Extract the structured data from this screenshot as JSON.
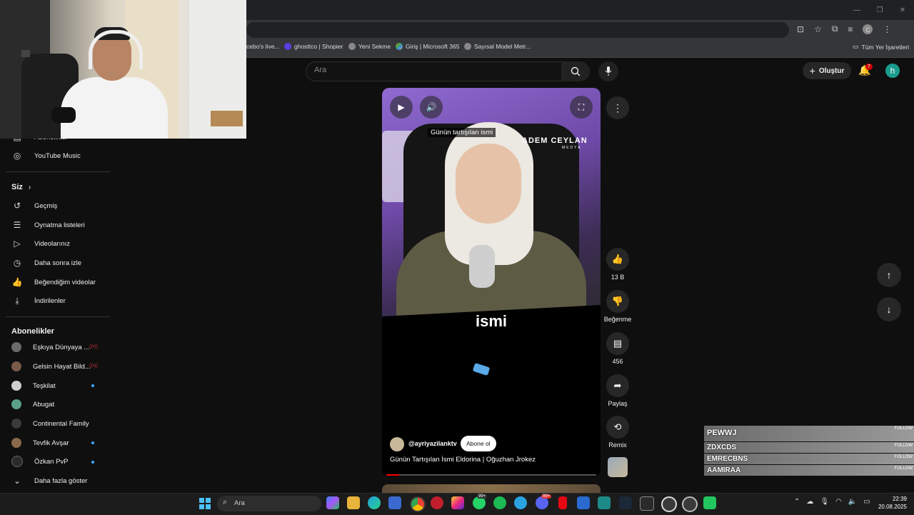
{
  "browser": {
    "bookmarks": [
      {
        "label": "cebo's live...",
        "icon": "globe-icon"
      },
      {
        "label": "ghosttco | Shopier",
        "icon": "shopier-icon"
      },
      {
        "label": "Yeni Sekme",
        "icon": "globe-icon"
      },
      {
        "label": "Giriş | Microsoft 365",
        "icon": "microsoft-icon"
      },
      {
        "label": "Sayısal Model Metr...",
        "icon": "globe-icon"
      }
    ],
    "all_bookmarks": "Tüm Yer İşaretleri",
    "profile_initial": "c"
  },
  "youtube": {
    "search_placeholder": "Ara",
    "create_label": "Oluştur",
    "notifications_count": "7",
    "avatar_initial": "h"
  },
  "sidebar": {
    "top_items": [
      {
        "label": "Abonelikler",
        "icon": "subscriptions-icon"
      },
      {
        "label": "YouTube Music",
        "icon": "youtube-music-icon"
      }
    ],
    "you_heading": "Siz",
    "you_items": [
      {
        "label": "Geçmiş",
        "icon": "history-icon"
      },
      {
        "label": "Oynatma listeleri",
        "icon": "playlist-icon"
      },
      {
        "label": "Videolarınız",
        "icon": "your-videos-icon"
      },
      {
        "label": "Daha sonra izle",
        "icon": "watch-later-icon"
      },
      {
        "label": "Beğendiğim videolar",
        "icon": "liked-icon"
      },
      {
        "label": "İndirilenler",
        "icon": "download-icon"
      }
    ],
    "subs_heading": "Abonelikler",
    "subscriptions": [
      {
        "label": "Eşkıya Dünyaya ...",
        "status": "live",
        "color": "#6a6a6a"
      },
      {
        "label": "Gelsin Hayat Bild...",
        "status": "live",
        "color": "#7a5a4a"
      },
      {
        "label": "Teşkilat",
        "status": "new",
        "color": "#cfcfcf"
      },
      {
        "label": "Abugat",
        "status": "none",
        "color": "#5aa08a"
      },
      {
        "label": "Continental Family",
        "status": "none",
        "color": "#3a3a3a"
      },
      {
        "label": "Tevfik Avşar",
        "status": "new",
        "color": "#8a6a4a"
      },
      {
        "label": "Özkan PvP",
        "status": "new",
        "color": "#2a2a2a"
      }
    ],
    "show_more": "Daha fazla göster"
  },
  "short": {
    "overlay_label": "Günün tartışılan ismi",
    "brand": "ADEM CEYLAN",
    "brand_sub": "MEDYA",
    "caption": "ismi",
    "channel": "@ayriyazilanktv",
    "subscribe_label": "Abone ol",
    "title": "Günün Tartışılan İsmi Eldorina | Oğuzhan Jrokez",
    "progress": 0.06,
    "likes": "13 B",
    "dislike_label": "Beğenme",
    "comments": "456",
    "share_label": "Paylaş",
    "remix_label": "Remix"
  },
  "stream_overlay": {
    "rows": [
      {
        "name": "PEWWJ",
        "tag": "FOLLOW"
      },
      {
        "name": "ZDXCDS",
        "tag": "FOLLOW"
      },
      {
        "name": "EMRECBNS",
        "tag": "FOLLOW"
      },
      {
        "name": "AAMIRAA",
        "tag": "FOLLOW"
      }
    ]
  },
  "taskbar": {
    "search_placeholder": "Ara",
    "time": "22:39",
    "date": "20.08.2025",
    "whatsapp_badge": "99+",
    "discord_badge": "99+"
  }
}
